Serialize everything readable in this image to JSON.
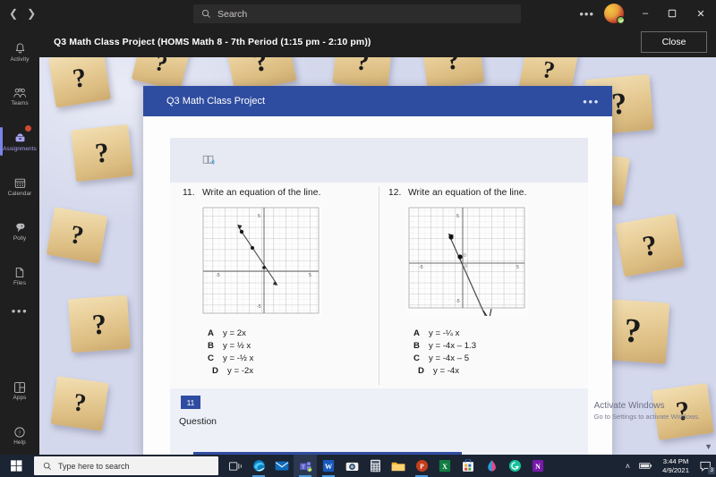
{
  "titlebar": {
    "back_icon": "chevron-left-icon",
    "forward_icon": "chevron-right-icon",
    "search_placeholder": "Search",
    "more_label": "•••",
    "minimize_label": "–",
    "maximize_label": "☐",
    "close_label": "✕"
  },
  "rail": {
    "items": [
      {
        "label": "Activity",
        "icon": "bell-icon",
        "active": false,
        "badge": false
      },
      {
        "label": "Teams",
        "icon": "people-icon",
        "active": false,
        "badge": false
      },
      {
        "label": "Assignments",
        "icon": "assignments-icon",
        "active": true,
        "badge": true
      },
      {
        "label": "Calendar",
        "icon": "calendar-icon",
        "active": false,
        "badge": false
      },
      {
        "label": "Polly",
        "icon": "polly-icon",
        "active": false,
        "badge": false
      },
      {
        "label": "Files",
        "icon": "file-icon",
        "active": false,
        "badge": false
      }
    ],
    "more_label": "•••",
    "bottom": [
      {
        "label": "Apps",
        "icon": "apps-icon"
      },
      {
        "label": "Help",
        "icon": "help-icon"
      }
    ]
  },
  "meeting": {
    "title": "Q3 Math Class Project (HOMS Math 8 - 7th Period (1:15 pm - 2:10 pm))",
    "close_label": "Close"
  },
  "assignment": {
    "title": "Q3 Math Class Project",
    "menu_label": "•••",
    "toolbar_icon": "immersive-reader-icon",
    "questions": [
      {
        "number": "11.",
        "prompt": "Write an equation of the line.",
        "graph": {
          "x_labels": [
            "-5",
            "5"
          ],
          "y_labels": [
            "5",
            "-5"
          ],
          "line": "steep negative slope through origin"
        },
        "choices": [
          {
            "letter": "A",
            "text": "y = 2x"
          },
          {
            "letter": "B",
            "text": "y = ½ x"
          },
          {
            "letter": "C",
            "text": "y = -½ x"
          },
          {
            "letter": "D",
            "text": "y = -2x"
          }
        ]
      },
      {
        "number": "12.",
        "prompt": "Write an equation of the line.",
        "graph": {
          "x_labels": [
            "-5",
            "5"
          ],
          "y_labels": [
            "5",
            "-5"
          ],
          "line": "very steep negative slope"
        },
        "choices": [
          {
            "letter": "A",
            "text": "y = -¼ x"
          },
          {
            "letter": "B",
            "text": "y = -4x – 1.3"
          },
          {
            "letter": "C",
            "text": "y = -4x – 5"
          },
          {
            "letter": "D",
            "text": "y = -4x"
          }
        ]
      }
    ],
    "footer": {
      "badge": "11",
      "label": "Question"
    }
  },
  "watermark": {
    "line1": "Activate Windows",
    "line2": "Go to Settings to activate Windows."
  },
  "taskbar": {
    "start_icon": "windows-icon",
    "search_placeholder": "Type here to search",
    "search_icon": "search-icon",
    "icons": [
      {
        "name": "task-view-icon",
        "active": false
      },
      {
        "name": "edge-icon",
        "active": true
      },
      {
        "name": "mail-icon",
        "active": false
      },
      {
        "name": "teams-icon",
        "active": true
      },
      {
        "name": "word-icon",
        "active": true
      },
      {
        "name": "camera-icon",
        "active": false
      },
      {
        "name": "calculator-icon",
        "active": false
      },
      {
        "name": "file-explorer-icon",
        "active": false
      },
      {
        "name": "powerpoint-icon",
        "active": true
      },
      {
        "name": "excel-icon",
        "active": false
      },
      {
        "name": "store-icon",
        "active": false
      },
      {
        "name": "paint3d-icon",
        "active": false
      },
      {
        "name": "grammarly-icon",
        "active": false
      },
      {
        "name": "onenote-icon",
        "active": false
      }
    ],
    "tray": {
      "chevron": "˄",
      "battery_icon": "battery-icon",
      "time": "3:44 PM",
      "date": "4/9/2021",
      "notification_count": "3"
    }
  },
  "colors": {
    "accent_blue": "#2f4da0",
    "teams_purple": "#7b83eb",
    "dark_chrome": "#1f1f1f",
    "taskbar": "#1b2433"
  }
}
